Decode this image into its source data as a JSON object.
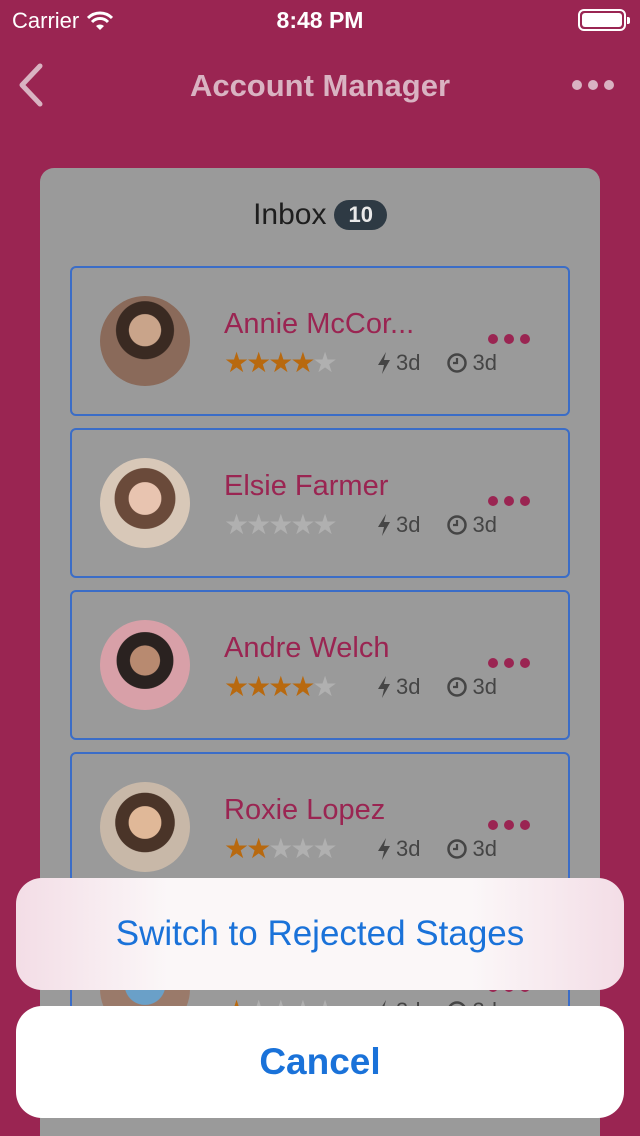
{
  "status_bar": {
    "carrier": "Carrier",
    "time": "8:48 PM"
  },
  "nav": {
    "title": "Account Manager"
  },
  "inbox": {
    "title": "Inbox",
    "count": "10"
  },
  "items": [
    {
      "name": "Annie McCor...",
      "rating": 4,
      "response": "3d",
      "age": "3d"
    },
    {
      "name": "Elsie Farmer",
      "rating": 0,
      "response": "3d",
      "age": "3d"
    },
    {
      "name": "Andre Welch",
      "rating": 4,
      "response": "3d",
      "age": "3d"
    },
    {
      "name": "Roxie Lopez",
      "rating": 2,
      "response": "3d",
      "age": "3d"
    },
    {
      "name": "",
      "rating": 1,
      "response": "3d",
      "age": "3d"
    }
  ],
  "action_sheet": {
    "action_label": "Switch to Rejected Stages",
    "cancel_label": "Cancel"
  },
  "colors": {
    "brand": "#9a2552",
    "accent_blue": "#1a72d9",
    "star": "#b8690f"
  }
}
